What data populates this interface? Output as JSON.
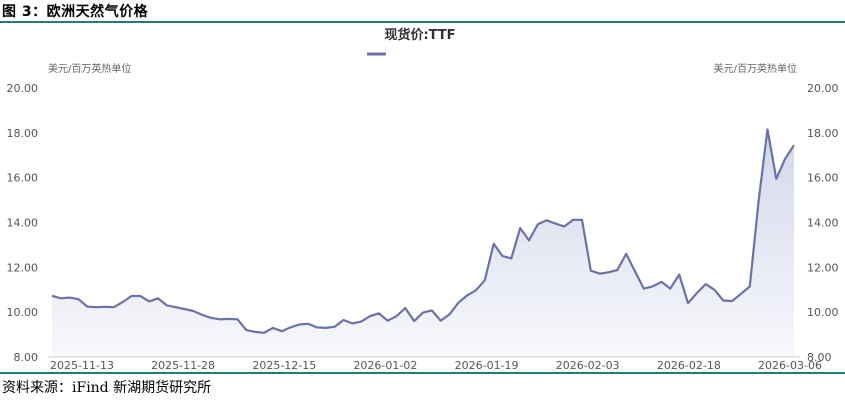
{
  "header": {
    "figure_title": "图 3：欧洲天然气价格"
  },
  "footer": {
    "source": "资料来源：iFind 新湖期货研究所"
  },
  "colors": {
    "rule": "#1f7f74",
    "line": "#6b72ab",
    "area_top": "#d4d7ea",
    "area_bottom": "#f7f8fc"
  },
  "chart_data": {
    "type": "area",
    "title": "现货价:TTF",
    "y_unit_left": "美元/百万英热单位",
    "y_unit_right": "美元/百万英热单位",
    "ylim": [
      8,
      20
    ],
    "y_ticks": [
      "8.00",
      "10.00",
      "12.00",
      "14.00",
      "16.00",
      "18.00",
      "20.00"
    ],
    "x_tick_labels": [
      "2025-11-13",
      "2025-11-28",
      "2025-12-15",
      "2026-01-02",
      "2026-01-19",
      "2026-02-03",
      "2026-02-18",
      "2026-03-06"
    ],
    "series": [
      {
        "name": "现货价:TTF",
        "values": [
          10.73,
          10.62,
          10.65,
          10.58,
          10.25,
          10.22,
          10.24,
          10.22,
          10.45,
          10.72,
          10.72,
          10.48,
          10.62,
          10.3,
          10.22,
          10.14,
          10.05,
          9.88,
          9.75,
          9.68,
          9.7,
          9.68,
          9.2,
          9.12,
          9.08,
          9.3,
          9.15,
          9.32,
          9.45,
          9.48,
          9.32,
          9.3,
          9.35,
          9.65,
          9.5,
          9.58,
          9.82,
          9.95,
          9.62,
          9.82,
          10.18,
          9.6,
          9.98,
          10.08,
          9.62,
          9.9,
          10.42,
          10.75,
          10.98,
          11.42,
          13.05,
          12.5,
          12.4,
          13.75,
          13.2,
          13.92,
          14.1,
          13.95,
          13.82,
          14.12,
          14.12,
          11.85,
          11.72,
          11.78,
          11.88,
          12.6,
          11.82,
          11.05,
          11.15,
          11.35,
          11.05,
          11.68,
          10.4,
          10.85,
          11.25,
          11.0,
          10.52,
          10.5,
          10.82,
          11.15,
          15.0,
          18.15,
          15.95,
          16.85,
          17.45
        ]
      }
    ],
    "legend": "top-center",
    "grid": false
  }
}
